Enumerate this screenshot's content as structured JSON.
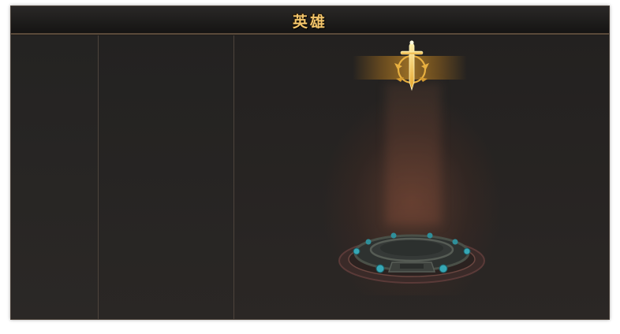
{
  "window": {
    "title": "英雄"
  },
  "colors": {
    "title_gold": "#f3c56b",
    "panel_bg": "#1f1d1c",
    "divider": "#4d443c",
    "gem_teal": "#36a7b5"
  },
  "icons": {
    "hero_emblem": "sword-emblem-icon",
    "summon_pedestal": "pedestal-icon"
  }
}
